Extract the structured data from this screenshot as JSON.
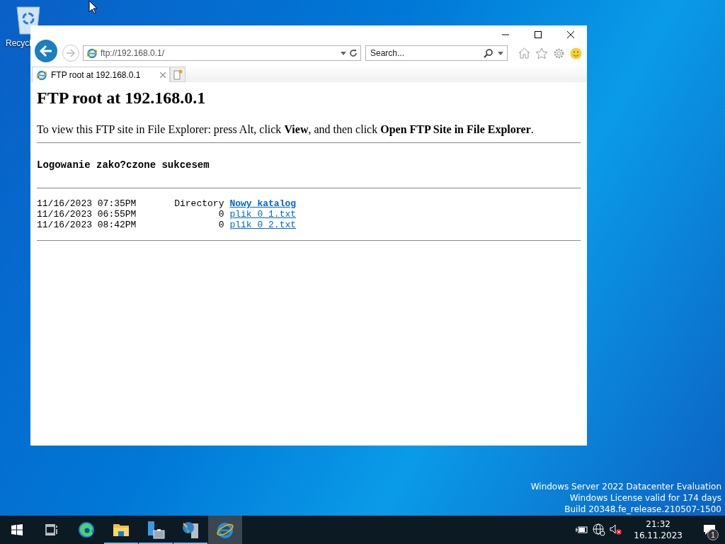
{
  "desktop": {
    "icons": [
      {
        "label": "Recycl"
      }
    ],
    "watermark": [
      "Windows Server 2022 Datacenter Evaluation",
      "Windows License valid for 174 days",
      "Build 20348.fe_release.210507-1500"
    ]
  },
  "browser": {
    "address": "ftp://192.168.0.1/",
    "search": {
      "placeholder": "Search..."
    },
    "tabs": [
      {
        "label": "FTP root at 192.168.0.1",
        "selected": true
      }
    ],
    "page": {
      "heading": "FTP root at 192.168.0.1",
      "instructions": "To view this FTP site in File Explorer: press Alt, click **View**, and then click **Open FTP Site in File Explorer**.",
      "message": "Logowanie zako?czone sukcesem",
      "listing": [
        {
          "date": "11/16/2023 07:35PM",
          "size": "Directory",
          "name": "Nowy katalog",
          "kind": "directory"
        },
        {
          "date": "11/16/2023 06:55PM",
          "size": "0",
          "name": "plik 0 1.txt",
          "kind": "file"
        },
        {
          "date": "11/16/2023 08:42PM",
          "size": "0",
          "name": "plik 0 2.txt",
          "kind": "file"
        }
      ]
    }
  },
  "taskbar": {
    "apps": [
      {
        "kind": "taskview",
        "running": false,
        "selected": false
      },
      {
        "kind": "edge",
        "running": false,
        "selected": false
      },
      {
        "kind": "explorer",
        "running": true,
        "selected": false
      },
      {
        "kind": "servermanager",
        "running": true,
        "selected": false
      },
      {
        "kind": "network",
        "running": true,
        "selected": false
      },
      {
        "kind": "ie",
        "running": false,
        "selected": true
      }
    ],
    "time": "21:32",
    "date": "16.11.2023",
    "notifications": "1"
  }
}
